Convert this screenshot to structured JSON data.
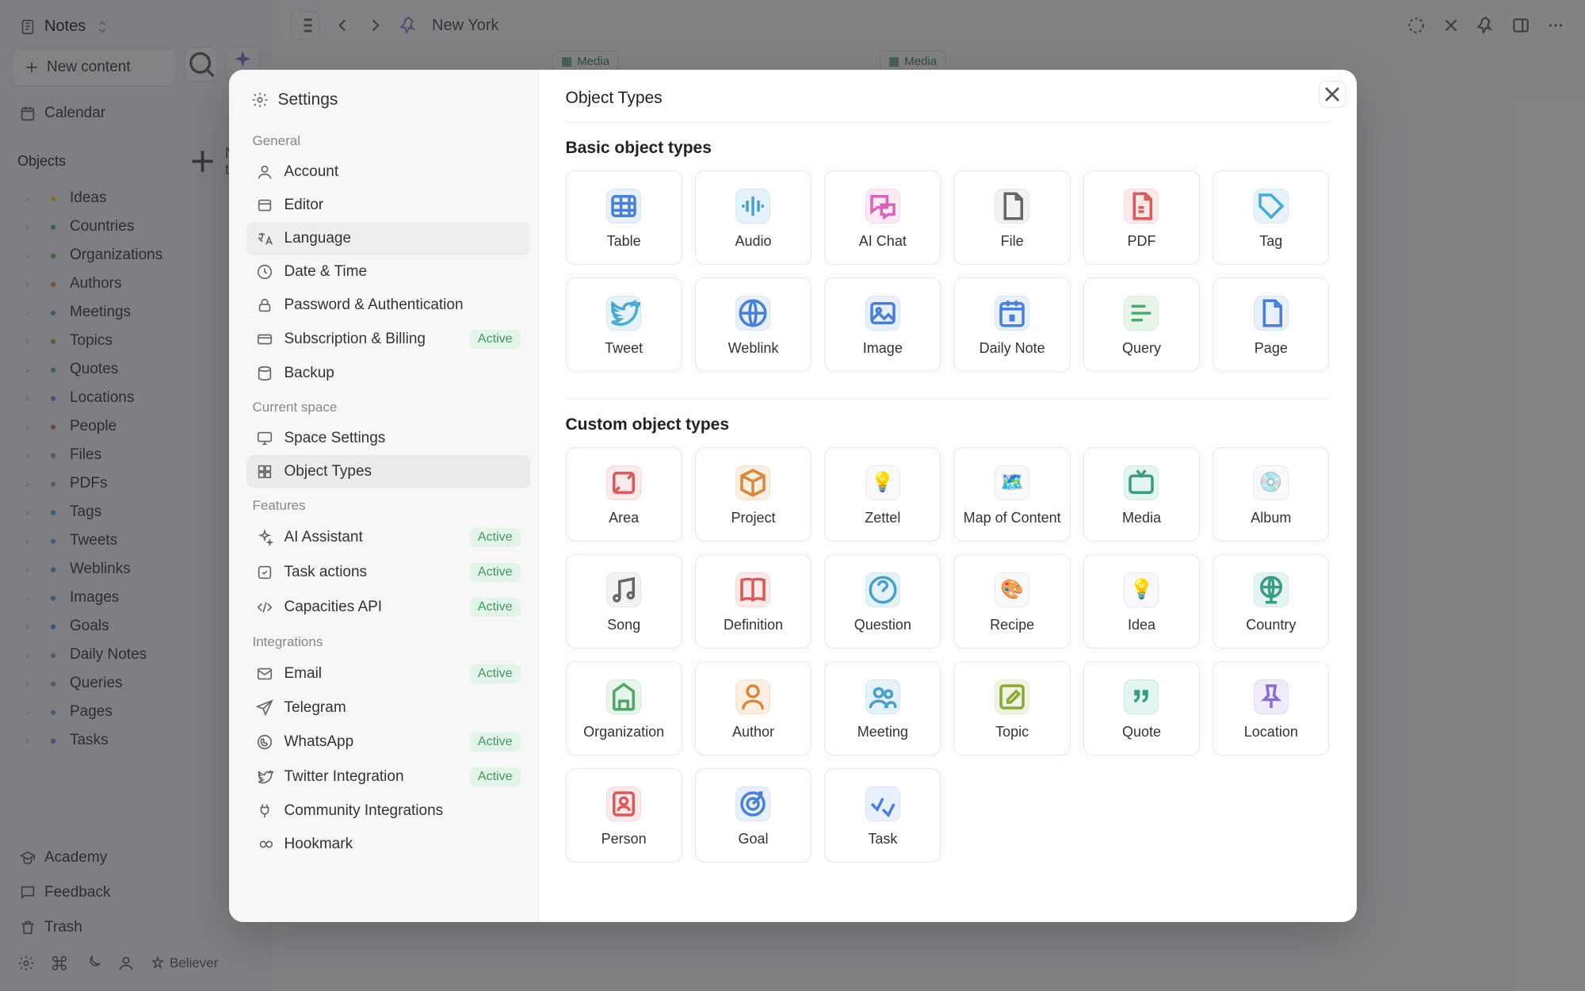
{
  "sidebar": {
    "space_title": "Notes",
    "new_content": "New content",
    "calendar": "Calendar",
    "objects_header": "Objects",
    "new_type": "New typ",
    "objects": [
      {
        "label": "Ideas",
        "color": "#f2d74a"
      },
      {
        "label": "Countries",
        "color": "#5fb58a"
      },
      {
        "label": "Organizations",
        "color": "#7fb86a"
      },
      {
        "label": "Authors",
        "color": "#d8936a"
      },
      {
        "label": "Meetings",
        "color": "#6aa8c8"
      },
      {
        "label": "Topics",
        "color": "#9fba5a"
      },
      {
        "label": "Quotes",
        "color": "#6ab8a8"
      },
      {
        "label": "Locations",
        "color": "#9a8ad0"
      },
      {
        "label": "People",
        "color": "#d87a7a"
      },
      {
        "label": "Files",
        "color": "#a8a8b0"
      },
      {
        "label": "PDFs",
        "color": "#a8a8b0"
      },
      {
        "label": "Tags",
        "color": "#6aa8d4"
      },
      {
        "label": "Tweets",
        "color": "#6ab8d8"
      },
      {
        "label": "Weblinks",
        "color": "#6aa8d4"
      },
      {
        "label": "Images",
        "color": "#6aa8c8"
      },
      {
        "label": "Goals",
        "color": "#6a98d4"
      },
      {
        "label": "Daily Notes",
        "color": "#b89aa8"
      },
      {
        "label": "Queries",
        "color": "#8ab88a"
      },
      {
        "label": "Pages",
        "color": "#8aa8d4"
      },
      {
        "label": "Tasks",
        "color": "#8a9ad0"
      }
    ],
    "academy": "Academy",
    "feedback": "Feedback",
    "trash": "Trash",
    "believer": "Believer"
  },
  "topbar": {
    "page": "New York",
    "media_label": "Media"
  },
  "modal": {
    "title": "Settings",
    "right_title": "Object Types",
    "basic_header": "Basic object types",
    "custom_header": "Custom object types",
    "sections": {
      "general": "General",
      "current_space": "Current space",
      "features": "Features",
      "integrations": "Integrations"
    },
    "nav": {
      "general": [
        {
          "label": "Account",
          "icon": "user"
        },
        {
          "label": "Editor",
          "icon": "editor"
        },
        {
          "label": "Language",
          "icon": "lang",
          "hover": true
        },
        {
          "label": "Date & Time",
          "icon": "clock"
        },
        {
          "label": "Password & Authentication",
          "icon": "lock"
        },
        {
          "label": "Subscription & Billing",
          "icon": "card",
          "badge": "Active"
        },
        {
          "label": "Backup",
          "icon": "backup"
        }
      ],
      "current_space": [
        {
          "label": "Space Settings",
          "icon": "monitor"
        },
        {
          "label": "Object Types",
          "icon": "grid",
          "active": true
        }
      ],
      "features": [
        {
          "label": "AI Assistant",
          "icon": "sparkle",
          "badge": "Active"
        },
        {
          "label": "Task actions",
          "icon": "check",
          "badge": "Active"
        },
        {
          "label": "Capacities API",
          "icon": "code",
          "badge": "Active"
        }
      ],
      "integrations": [
        {
          "label": "Email",
          "icon": "mail",
          "badge": "Active"
        },
        {
          "label": "Telegram",
          "icon": "send"
        },
        {
          "label": "WhatsApp",
          "icon": "whatsapp",
          "badge": "Active"
        },
        {
          "label": "Twitter Integration",
          "icon": "twitter",
          "badge": "Active"
        },
        {
          "label": "Community Integrations",
          "icon": "plug"
        },
        {
          "label": "Hookmark",
          "icon": "infinity"
        }
      ]
    },
    "basic_types": [
      {
        "label": "Table",
        "cls": "ic-blue",
        "icon": "table"
      },
      {
        "label": "Audio",
        "cls": "ic-cyan",
        "icon": "audio"
      },
      {
        "label": "AI Chat",
        "cls": "ic-pink",
        "icon": "chat"
      },
      {
        "label": "File",
        "cls": "ic-gray",
        "icon": "file"
      },
      {
        "label": "PDF",
        "cls": "ic-red",
        "icon": "pdf"
      },
      {
        "label": "Tag",
        "cls": "ic-sky",
        "icon": "tag"
      },
      {
        "label": "Tweet",
        "cls": "ic-sky",
        "icon": "twitter"
      },
      {
        "label": "Weblink",
        "cls": "ic-blue",
        "icon": "globe"
      },
      {
        "label": "Image",
        "cls": "ic-blue",
        "icon": "image"
      },
      {
        "label": "Daily Note",
        "cls": "ic-blue",
        "icon": "calendar"
      },
      {
        "label": "Query",
        "cls": "ic-green",
        "icon": "query"
      },
      {
        "label": "Page",
        "cls": "ic-blue",
        "icon": "page"
      }
    ],
    "custom_types": [
      {
        "label": "Area",
        "cls": "ic-red",
        "icon": "area"
      },
      {
        "label": "Project",
        "cls": "ic-orange",
        "icon": "box"
      },
      {
        "label": "Zettel",
        "cls": "ic-emoji",
        "icon": "💡"
      },
      {
        "label": "Map of Content",
        "cls": "ic-emoji",
        "icon": "🗺️"
      },
      {
        "label": "Media",
        "cls": "ic-teal",
        "icon": "tv"
      },
      {
        "label": "Album",
        "cls": "ic-emoji",
        "icon": "💿"
      },
      {
        "label": "Song",
        "cls": "ic-gray",
        "icon": "music"
      },
      {
        "label": "Definition",
        "cls": "ic-red",
        "icon": "book"
      },
      {
        "label": "Question",
        "cls": "ic-cyan",
        "icon": "help"
      },
      {
        "label": "Recipe",
        "cls": "ic-emoji",
        "icon": "🎨"
      },
      {
        "label": "Idea",
        "cls": "ic-emoji",
        "icon": "💡"
      },
      {
        "label": "Country",
        "cls": "ic-teal",
        "icon": "globe2"
      },
      {
        "label": "Organization",
        "cls": "ic-green",
        "icon": "building"
      },
      {
        "label": "Author",
        "cls": "ic-orange",
        "icon": "person"
      },
      {
        "label": "Meeting",
        "cls": "ic-cyan",
        "icon": "people"
      },
      {
        "label": "Topic",
        "cls": "ic-lime",
        "icon": "edit"
      },
      {
        "label": "Quote",
        "cls": "ic-teal",
        "icon": "quote"
      },
      {
        "label": "Location",
        "cls": "ic-purple",
        "icon": "pin"
      },
      {
        "label": "Person",
        "cls": "ic-red",
        "icon": "contact"
      },
      {
        "label": "Goal",
        "cls": "ic-blue",
        "icon": "target"
      },
      {
        "label": "Task",
        "cls": "ic-blue",
        "icon": "task"
      }
    ]
  }
}
